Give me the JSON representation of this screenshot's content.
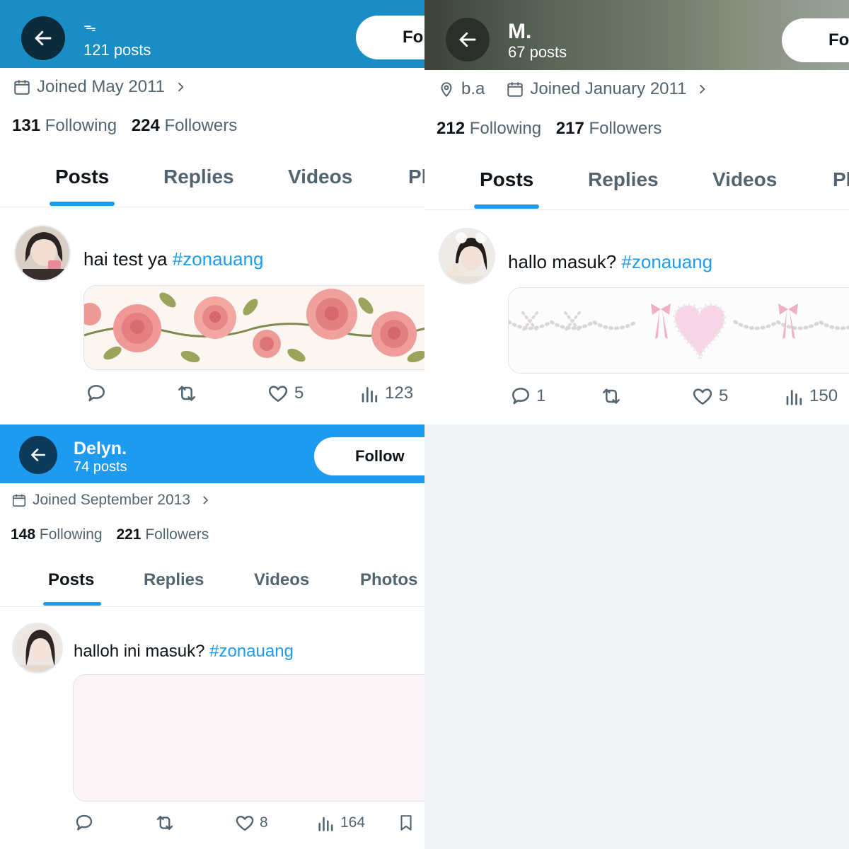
{
  "panels": [
    {
      "header": {
        "name": "ᯓ",
        "posts": "121 posts",
        "follow": "Follow"
      },
      "meta": {
        "location": "",
        "joined": "Joined May 2011"
      },
      "stats": {
        "following_count": "131",
        "following_label": "Following",
        "followers_count": "224",
        "followers_label": "Followers"
      },
      "tabs": [
        "Posts",
        "Replies",
        "Videos",
        "Photos"
      ],
      "tweet": {
        "text": "hai test ya ",
        "hashtag": "#zonauang",
        "reply_count": "",
        "like_count": "5",
        "view_count": "123"
      }
    },
    {
      "header": {
        "name": "M.",
        "posts": "67 posts",
        "follow": "Follow"
      },
      "meta": {
        "location": "b.a",
        "joined": "Joined January 2011"
      },
      "stats": {
        "following_count": "212",
        "following_label": "Following",
        "followers_count": "217",
        "followers_label": "Followers"
      },
      "tabs": [
        "Posts",
        "Replies",
        "Videos",
        "Photos"
      ],
      "tweet": {
        "text": "hallo masuk? ",
        "hashtag": "#zonauang",
        "reply_count": "1",
        "like_count": "5",
        "view_count": "150"
      }
    },
    {
      "header": {
        "name": "Delyn.",
        "posts": "74 posts",
        "follow": "Follow"
      },
      "meta": {
        "location": "",
        "joined": "Joined September 2013"
      },
      "stats": {
        "following_count": "148",
        "following_label": "Following",
        "followers_count": "221",
        "followers_label": "Followers"
      },
      "tabs": [
        "Posts",
        "Replies",
        "Videos",
        "Photos"
      ],
      "tweet": {
        "text": "halloh ini masuk? ",
        "hashtag": "#zonauang",
        "reply_count": "",
        "like_count": "8",
        "view_count": "164"
      }
    }
  ],
  "colors": {
    "accent": "#1d9bf0",
    "header_a": "#1a8ec4",
    "header_c": "#1d9bf0",
    "muted": "#536471"
  },
  "icons": [
    "back-arrow-icon",
    "calendar-icon",
    "location-pin-icon",
    "chevron-right-icon",
    "reply-icon",
    "retweet-icon",
    "like-icon",
    "views-icon",
    "bookmark-icon"
  ]
}
